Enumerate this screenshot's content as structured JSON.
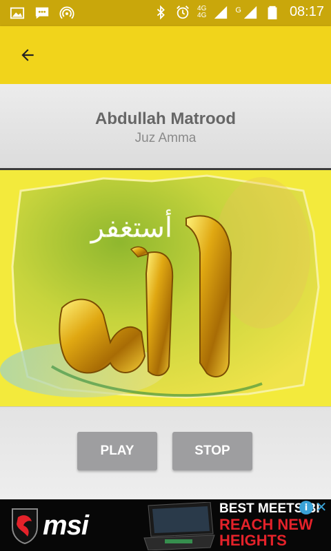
{
  "status_bar": {
    "time": "08:17",
    "network_label_1": "4G",
    "network_label_2": "4G",
    "network_label_3": "G",
    "left_icons": [
      "gallery-icon",
      "chat-icon",
      "hotspot-icon"
    ],
    "right_icons": [
      "bluetooth-icon",
      "alarm-icon",
      "signal-icon",
      "battery-icon"
    ]
  },
  "app_bar": {
    "back_icon": "arrow-left-icon",
    "color": "#f1d41b"
  },
  "header": {
    "title": "Abdullah Matrood",
    "subtitle": "Juz Amma"
  },
  "artwork": {
    "arabic_text": "أستغفر الله"
  },
  "controls": {
    "play_label": "PLAY",
    "stop_label": "STOP"
  },
  "ad": {
    "brand": "msi",
    "headline_1": "BEST MEETS BI",
    "headline_2": "REACH NEW",
    "headline_3": "HEIGHTS",
    "choices_label": "i",
    "close_label": "✕"
  },
  "colors": {
    "status_bar": "#c9a70b",
    "accent": "#f1d41b",
    "button": "#9e9ea0",
    "ad_red": "#e4222a"
  }
}
